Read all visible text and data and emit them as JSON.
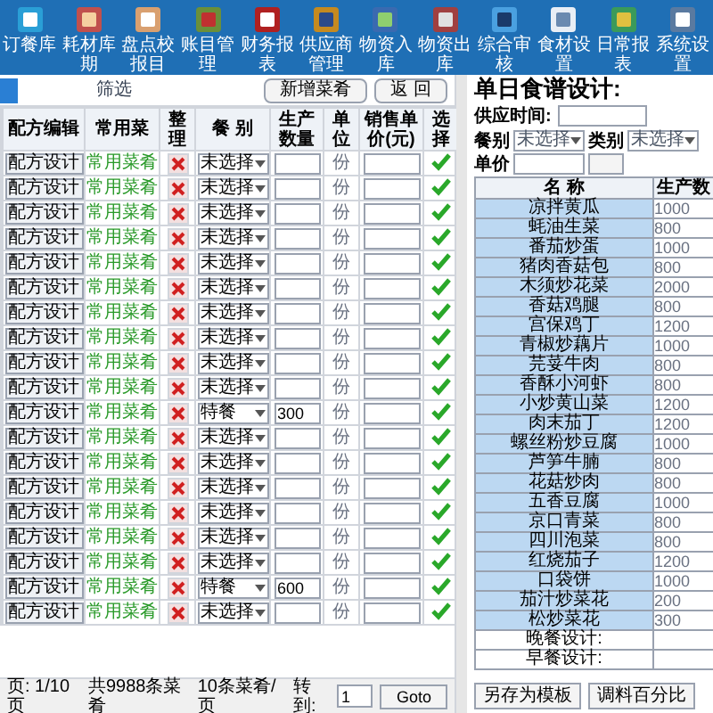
{
  "toolbar": [
    {
      "label": "订餐库"
    },
    {
      "label": "耗材库期"
    },
    {
      "label": "盘点校报目"
    },
    {
      "label": "账目管理"
    },
    {
      "label": "财务报表"
    },
    {
      "label": "供应商管理"
    },
    {
      "label": "物资入库"
    },
    {
      "label": "物资出库"
    },
    {
      "label": "综合审核"
    },
    {
      "label": "食材设置"
    },
    {
      "label": "日常报表"
    },
    {
      "label": "系统设置"
    }
  ],
  "recipe_list": {
    "filter_label": "筛选",
    "buttons": [
      "新增菜肴",
      "返 回"
    ],
    "columns": [
      "配方编辑",
      "常用菜",
      "整理",
      "餐 别",
      "生产数量",
      "单位",
      "销售单价(元)",
      "选择"
    ],
    "rows": [
      {
        "design_button": "配方设计",
        "category": "常用菜肴",
        "meal": "未选择",
        "unit": "份",
        "selected": true
      },
      {
        "design_button": "配方设计",
        "category": "常用菜肴",
        "meal": "未选择",
        "unit": "份",
        "selected": true
      },
      {
        "design_button": "配方设计",
        "category": "常用菜肴",
        "meal": "未选择",
        "unit": "份",
        "selected": true
      },
      {
        "design_button": "配方设计",
        "category": "常用菜肴",
        "meal": "未选择",
        "unit": "份",
        "selected": true
      },
      {
        "design_button": "配方设计",
        "category": "常用菜肴",
        "meal": "未选择",
        "unit": "份",
        "selected": true
      },
      {
        "design_button": "配方设计",
        "category": "常用菜肴",
        "meal": "未选择",
        "unit": "份",
        "selected": true
      },
      {
        "design_button": "配方设计",
        "category": "常用菜肴",
        "meal": "未选择",
        "unit": "份",
        "selected": true
      },
      {
        "design_button": "配方设计",
        "category": "常用菜肴",
        "meal": "未选择",
        "unit": "份",
        "selected": true
      },
      {
        "design_button": "配方设计",
        "category": "常用菜肴",
        "meal": "未选择",
        "unit": "份",
        "selected": true
      },
      {
        "design_button": "配方设计",
        "category": "常用菜肴",
        "meal": "未选择",
        "unit": "份",
        "selected": true
      },
      {
        "design_button": "配方设计",
        "category": "常用菜肴",
        "meal": "特餐",
        "quantity": "300",
        "unit": "份",
        "selected": true
      },
      {
        "design_button": "配方设计",
        "category": "常用菜肴",
        "meal": "未选择",
        "unit": "份",
        "selected": true
      },
      {
        "design_button": "配方设计",
        "category": "常用菜肴",
        "meal": "未选择",
        "unit": "份",
        "selected": true
      },
      {
        "design_button": "配方设计",
        "category": "常用菜肴",
        "meal": "未选择",
        "unit": "份",
        "selected": true
      },
      {
        "design_button": "配方设计",
        "category": "常用菜肴",
        "meal": "未选择",
        "unit": "份",
        "selected": true
      },
      {
        "design_button": "配方设计",
        "category": "常用菜肴",
        "meal": "未选择",
        "unit": "份",
        "selected": true
      },
      {
        "design_button": "配方设计",
        "category": "常用菜肴",
        "meal": "未选择",
        "unit": "份",
        "selected": true
      },
      {
        "design_button": "配方设计",
        "category": "常用菜肴",
        "meal": "特餐",
        "quantity": "600",
        "unit": "份",
        "selected": true
      },
      {
        "design_button": "配方设计",
        "category": "常用菜肴",
        "meal": "未选择",
        "unit": "份",
        "selected": true
      }
    ],
    "pagination": {
      "page_info": "页: 1/10页",
      "total": "共9988条菜肴",
      "per_page": "10条菜肴/页",
      "goto_label": "转到:",
      "page_input": "1",
      "goto_button": "Goto"
    }
  },
  "daily_menu": {
    "title": "单日食谱设计:",
    "time_label": "供应时间:",
    "filters": [
      {
        "label": "餐别",
        "value": "未选择"
      },
      {
        "label": "类别",
        "value": "未选择"
      }
    ],
    "price_label": "单价",
    "columns": [
      "名 称",
      "生产数"
    ],
    "rows": [
      {
        "name": "凉拌黄瓜",
        "quantity": "1000",
        "highlighted": true
      },
      {
        "name": "蚝油生菜",
        "quantity": "800",
        "highlighted": true
      },
      {
        "name": "番茄炒蛋",
        "quantity": "1000",
        "highlighted": true
      },
      {
        "name": "猪肉香菇包",
        "quantity": "800",
        "highlighted": true
      },
      {
        "name": "木须炒花菜",
        "quantity": "2000",
        "highlighted": true
      },
      {
        "name": "香菇鸡腿",
        "quantity": "800",
        "highlighted": true
      },
      {
        "name": "宫保鸡丁",
        "quantity": "1200",
        "highlighted": true
      },
      {
        "name": "青椒炒藕片",
        "quantity": "1000",
        "highlighted": true
      },
      {
        "name": "芫荽牛肉",
        "quantity": "800",
        "highlighted": true
      },
      {
        "name": "香酥小河虾",
        "quantity": "800",
        "highlighted": true
      },
      {
        "name": "小炒黄山菜",
        "quantity": "1200",
        "highlighted": true
      },
      {
        "name": "肉末茄丁",
        "quantity": "1200",
        "highlighted": true
      },
      {
        "name": "螺丝粉炒豆腐",
        "quantity": "1000",
        "highlighted": true
      },
      {
        "name": "芦笋牛腩",
        "quantity": "800",
        "highlighted": true
      },
      {
        "name": "花菇炒肉",
        "quantity": "800",
        "highlighted": true
      },
      {
        "name": "五香豆腐",
        "quantity": "1000",
        "highlighted": true
      },
      {
        "name": "京口青菜",
        "quantity": "800",
        "highlighted": true
      },
      {
        "name": "四川泡菜",
        "quantity": "800",
        "highlighted": true
      },
      {
        "name": "红烧茄子",
        "quantity": "1200",
        "highlighted": true
      },
      {
        "name": "口袋饼",
        "quantity": "1000",
        "highlighted": true
      },
      {
        "name": "茄汁炒菜花",
        "quantity": "200",
        "highlighted": true
      },
      {
        "name": "松炒菜花",
        "quantity": "300",
        "highlighted": true
      },
      {
        "name": "晚餐设计:",
        "highlighted": false
      },
      {
        "name": "早餐设计:",
        "highlighted": false
      }
    ],
    "buttons": [
      "另存为模板",
      "调料百分比"
    ]
  }
}
